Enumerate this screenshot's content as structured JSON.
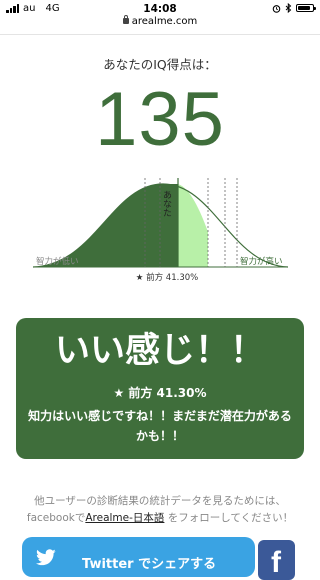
{
  "status_bar": {
    "carrier": "au",
    "network": "4G",
    "time": "14:08",
    "battery_level": 0.85
  },
  "browser": {
    "url": "arealme.com"
  },
  "result": {
    "heading": "あなたのIQ得点は：",
    "score": "135"
  },
  "chart": {
    "left_label": "智力が低い",
    "right_label": "智力が高い",
    "marker_label": "あなた",
    "percentile_label": "★ 前方 41.30%"
  },
  "card": {
    "title": "いい感じ！！",
    "rank": "★ 前方 41.30%",
    "message": "知力はいい感じですね！！まだまだ潜在力があるかも！！"
  },
  "footer": {
    "note_line1": "他ユーザーの診断結果の統計データを見るためには、",
    "note_prefix": "facebookで",
    "note_link": "Arealme-日本語",
    "note_suffix": " をフォローしてください！"
  },
  "share": {
    "twitter_label": "Twitter でシェアする",
    "facebook_glyph": "f"
  },
  "colors": {
    "primary_green": "#3f6e3b",
    "light_green": "#b8f0a8",
    "twitter_blue": "#3aa3e3",
    "facebook_blue": "#3b5998"
  }
}
